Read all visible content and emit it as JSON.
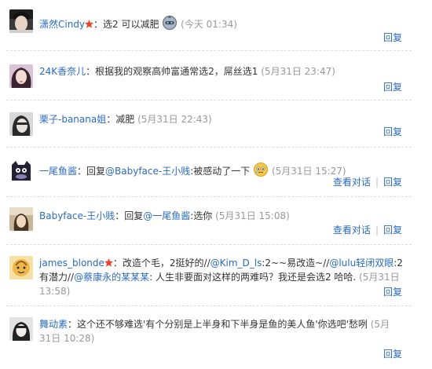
{
  "comments": [
    {
      "user": "潇然Cindy",
      "vip": true,
      "text": "：选2 可以减肥",
      "emoticon": "robot-face",
      "time": "(今天 01:34)",
      "actions": [
        "回复"
      ]
    },
    {
      "user": "24K香奈儿",
      "vip": false,
      "text": "：根据我的观察高帅富通常选2，屌丝选1",
      "time": "(5月31日 23:47)",
      "actions": [
        "回复"
      ]
    },
    {
      "user": "栗子-banana姐",
      "vip": false,
      "text": "：减肥",
      "time": "(5月31日 22:43)",
      "actions": [
        "回复"
      ]
    },
    {
      "user": "一尾鱼酱",
      "vip": false,
      "reply_prefix": "：回复",
      "mention": "@Babyface-王小贱",
      "text": ":被感动了一下",
      "emoticon": "tearful-face",
      "time": "(5月31日 15:27)",
      "actions": [
        "查看对话",
        "回复"
      ]
    },
    {
      "user": "Babyface-王小贱",
      "vip": false,
      "reply_prefix": "：回复",
      "mention": "@一尾鱼酱",
      "text": ":选你",
      "time": "(5月31日 15:08)",
      "actions": [
        "查看对话",
        "回复"
      ]
    },
    {
      "user": "james_blonde",
      "vip": true,
      "seg1": "：改造个毛，2挺好的//",
      "mention1": "@Kim_D_ls",
      "seg2": ":2~~易改造~//",
      "mention2": "@lulu轻闭双眼",
      "seg3": ":2有潜力//",
      "mention3": "@蔡康永的某某某",
      "seg4": ": 人生非要面对这样的两难吗？我还是会选2 哈哈.",
      "time": "(5月31日 13:58)",
      "actions": [
        "回复"
      ]
    },
    {
      "user": "舞动素",
      "vip": false,
      "text": "：这个还不够难选'有个分别是上半身和下半身是鱼的美人鱼'你选吧'愁咧",
      "time": "(5月31日 10:28)",
      "actions": [
        "回复"
      ]
    }
  ],
  "colors": {
    "link": "#2b6bbd",
    "time": "#999999",
    "text": "#333333",
    "divider": "#dcdcdc"
  }
}
